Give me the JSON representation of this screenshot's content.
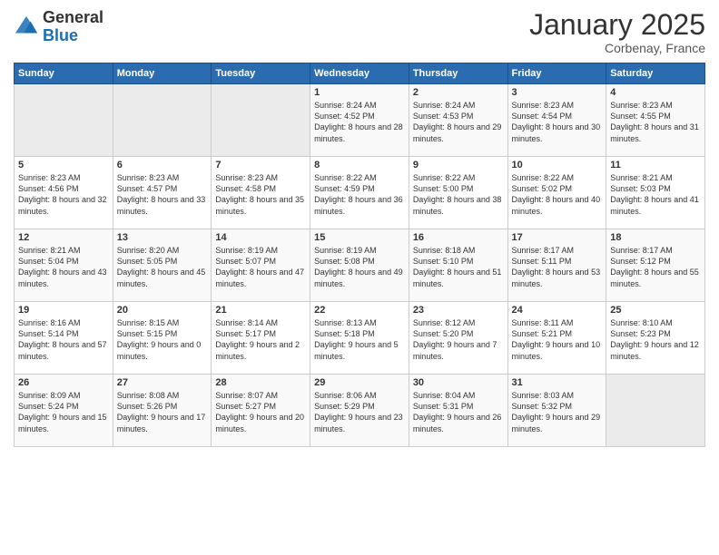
{
  "header": {
    "logo_line1": "General",
    "logo_line2": "Blue",
    "title": "January 2025",
    "subtitle": "Corbenay, France"
  },
  "days_of_week": [
    "Sunday",
    "Monday",
    "Tuesday",
    "Wednesday",
    "Thursday",
    "Friday",
    "Saturday"
  ],
  "weeks": [
    [
      {
        "day": "",
        "empty": true
      },
      {
        "day": "",
        "empty": true
      },
      {
        "day": "",
        "empty": true
      },
      {
        "day": "1",
        "sunrise": "Sunrise: 8:24 AM",
        "sunset": "Sunset: 4:52 PM",
        "daylight": "Daylight: 8 hours and 28 minutes."
      },
      {
        "day": "2",
        "sunrise": "Sunrise: 8:24 AM",
        "sunset": "Sunset: 4:53 PM",
        "daylight": "Daylight: 8 hours and 29 minutes."
      },
      {
        "day": "3",
        "sunrise": "Sunrise: 8:23 AM",
        "sunset": "Sunset: 4:54 PM",
        "daylight": "Daylight: 8 hours and 30 minutes."
      },
      {
        "day": "4",
        "sunrise": "Sunrise: 8:23 AM",
        "sunset": "Sunset: 4:55 PM",
        "daylight": "Daylight: 8 hours and 31 minutes."
      }
    ],
    [
      {
        "day": "5",
        "sunrise": "Sunrise: 8:23 AM",
        "sunset": "Sunset: 4:56 PM",
        "daylight": "Daylight: 8 hours and 32 minutes."
      },
      {
        "day": "6",
        "sunrise": "Sunrise: 8:23 AM",
        "sunset": "Sunset: 4:57 PM",
        "daylight": "Daylight: 8 hours and 33 minutes."
      },
      {
        "day": "7",
        "sunrise": "Sunrise: 8:23 AM",
        "sunset": "Sunset: 4:58 PM",
        "daylight": "Daylight: 8 hours and 35 minutes."
      },
      {
        "day": "8",
        "sunrise": "Sunrise: 8:22 AM",
        "sunset": "Sunset: 4:59 PM",
        "daylight": "Daylight: 8 hours and 36 minutes."
      },
      {
        "day": "9",
        "sunrise": "Sunrise: 8:22 AM",
        "sunset": "Sunset: 5:00 PM",
        "daylight": "Daylight: 8 hours and 38 minutes."
      },
      {
        "day": "10",
        "sunrise": "Sunrise: 8:22 AM",
        "sunset": "Sunset: 5:02 PM",
        "daylight": "Daylight: 8 hours and 40 minutes."
      },
      {
        "day": "11",
        "sunrise": "Sunrise: 8:21 AM",
        "sunset": "Sunset: 5:03 PM",
        "daylight": "Daylight: 8 hours and 41 minutes."
      }
    ],
    [
      {
        "day": "12",
        "sunrise": "Sunrise: 8:21 AM",
        "sunset": "Sunset: 5:04 PM",
        "daylight": "Daylight: 8 hours and 43 minutes."
      },
      {
        "day": "13",
        "sunrise": "Sunrise: 8:20 AM",
        "sunset": "Sunset: 5:05 PM",
        "daylight": "Daylight: 8 hours and 45 minutes."
      },
      {
        "day": "14",
        "sunrise": "Sunrise: 8:19 AM",
        "sunset": "Sunset: 5:07 PM",
        "daylight": "Daylight: 8 hours and 47 minutes."
      },
      {
        "day": "15",
        "sunrise": "Sunrise: 8:19 AM",
        "sunset": "Sunset: 5:08 PM",
        "daylight": "Daylight: 8 hours and 49 minutes."
      },
      {
        "day": "16",
        "sunrise": "Sunrise: 8:18 AM",
        "sunset": "Sunset: 5:10 PM",
        "daylight": "Daylight: 8 hours and 51 minutes."
      },
      {
        "day": "17",
        "sunrise": "Sunrise: 8:17 AM",
        "sunset": "Sunset: 5:11 PM",
        "daylight": "Daylight: 8 hours and 53 minutes."
      },
      {
        "day": "18",
        "sunrise": "Sunrise: 8:17 AM",
        "sunset": "Sunset: 5:12 PM",
        "daylight": "Daylight: 8 hours and 55 minutes."
      }
    ],
    [
      {
        "day": "19",
        "sunrise": "Sunrise: 8:16 AM",
        "sunset": "Sunset: 5:14 PM",
        "daylight": "Daylight: 8 hours and 57 minutes."
      },
      {
        "day": "20",
        "sunrise": "Sunrise: 8:15 AM",
        "sunset": "Sunset: 5:15 PM",
        "daylight": "Daylight: 9 hours and 0 minutes."
      },
      {
        "day": "21",
        "sunrise": "Sunrise: 8:14 AM",
        "sunset": "Sunset: 5:17 PM",
        "daylight": "Daylight: 9 hours and 2 minutes."
      },
      {
        "day": "22",
        "sunrise": "Sunrise: 8:13 AM",
        "sunset": "Sunset: 5:18 PM",
        "daylight": "Daylight: 9 hours and 5 minutes."
      },
      {
        "day": "23",
        "sunrise": "Sunrise: 8:12 AM",
        "sunset": "Sunset: 5:20 PM",
        "daylight": "Daylight: 9 hours and 7 minutes."
      },
      {
        "day": "24",
        "sunrise": "Sunrise: 8:11 AM",
        "sunset": "Sunset: 5:21 PM",
        "daylight": "Daylight: 9 hours and 10 minutes."
      },
      {
        "day": "25",
        "sunrise": "Sunrise: 8:10 AM",
        "sunset": "Sunset: 5:23 PM",
        "daylight": "Daylight: 9 hours and 12 minutes."
      }
    ],
    [
      {
        "day": "26",
        "sunrise": "Sunrise: 8:09 AM",
        "sunset": "Sunset: 5:24 PM",
        "daylight": "Daylight: 9 hours and 15 minutes."
      },
      {
        "day": "27",
        "sunrise": "Sunrise: 8:08 AM",
        "sunset": "Sunset: 5:26 PM",
        "daylight": "Daylight: 9 hours and 17 minutes."
      },
      {
        "day": "28",
        "sunrise": "Sunrise: 8:07 AM",
        "sunset": "Sunset: 5:27 PM",
        "daylight": "Daylight: 9 hours and 20 minutes."
      },
      {
        "day": "29",
        "sunrise": "Sunrise: 8:06 AM",
        "sunset": "Sunset: 5:29 PM",
        "daylight": "Daylight: 9 hours and 23 minutes."
      },
      {
        "day": "30",
        "sunrise": "Sunrise: 8:04 AM",
        "sunset": "Sunset: 5:31 PM",
        "daylight": "Daylight: 9 hours and 26 minutes."
      },
      {
        "day": "31",
        "sunrise": "Sunrise: 8:03 AM",
        "sunset": "Sunset: 5:32 PM",
        "daylight": "Daylight: 9 hours and 29 minutes."
      },
      {
        "day": "",
        "empty": true
      }
    ]
  ]
}
